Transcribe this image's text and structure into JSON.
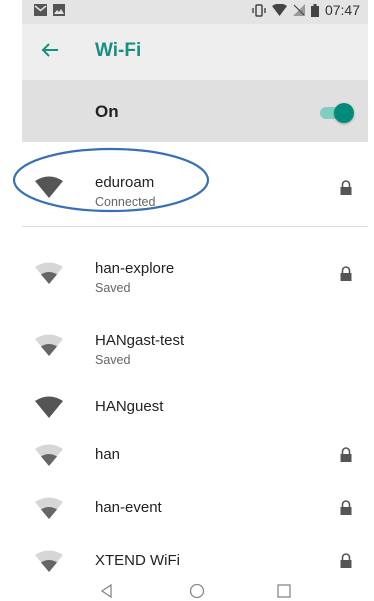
{
  "status_bar": {
    "time": "07:47"
  },
  "app_bar": {
    "title": "Wi-Fi"
  },
  "wifi_toggle": {
    "label": "On",
    "enabled": true
  },
  "networks": [
    {
      "name": "eduroam",
      "status": "Connected",
      "locked": true,
      "signal": "full"
    },
    {
      "name": "han-explore",
      "status": "Saved",
      "locked": true,
      "signal": "medium"
    },
    {
      "name": "HANgast-test",
      "status": "Saved",
      "locked": false,
      "signal": "medium"
    },
    {
      "name": "HANguest",
      "status": "",
      "locked": false,
      "signal": "full"
    },
    {
      "name": "han",
      "status": "",
      "locked": true,
      "signal": "medium"
    },
    {
      "name": "han-event",
      "status": "",
      "locked": true,
      "signal": "medium"
    },
    {
      "name": "XTEND WiFi",
      "status": "",
      "locked": true,
      "signal": "medium"
    }
  ],
  "colors": {
    "accent": "#1a8f80",
    "toggle_on": "#008b7a",
    "annotation": "#3a6fb7"
  },
  "icons": {
    "back": "arrow-left-icon",
    "wifi": "wifi-signal-icon",
    "lock": "lock-icon",
    "nav_back": "triangle-back-icon",
    "nav_home": "circle-home-icon",
    "nav_recents": "square-recents-icon"
  }
}
